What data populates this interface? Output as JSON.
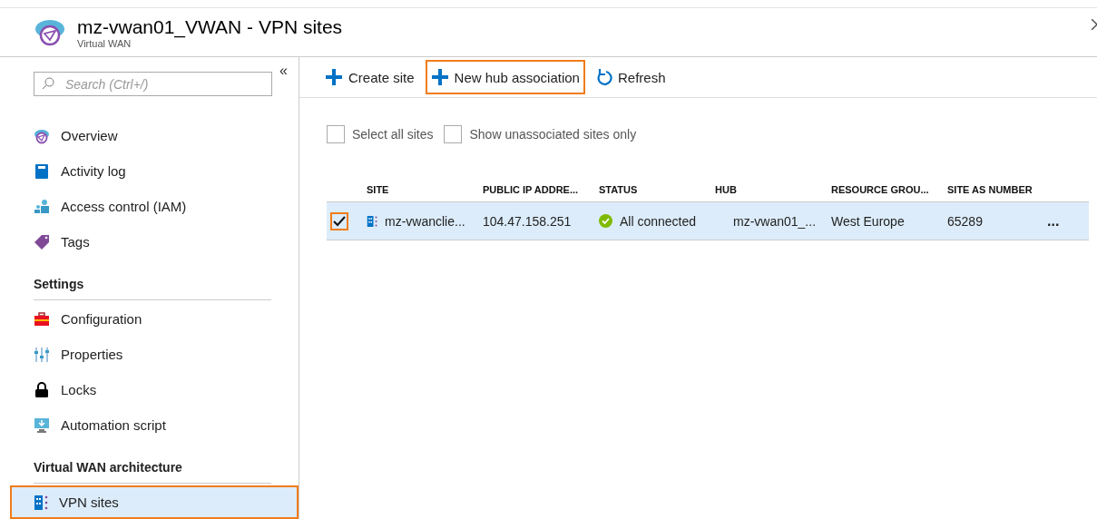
{
  "header": {
    "title": "mz-vwan01_VWAN - VPN sites",
    "subtitle": "Virtual WAN"
  },
  "sidebar": {
    "search": {
      "placeholder": "Search (Ctrl+/)"
    },
    "collapse": "«",
    "sections": [
      {
        "items": [
          {
            "label": "Overview",
            "selected": false,
            "highlighted": false
          },
          {
            "label": "Activity log",
            "selected": false,
            "highlighted": false
          },
          {
            "label": "Access control (IAM)",
            "selected": false,
            "highlighted": false
          },
          {
            "label": "Tags",
            "selected": false,
            "highlighted": false
          }
        ]
      },
      {
        "heading": "Settings",
        "items": [
          {
            "label": "Configuration",
            "selected": false,
            "highlighted": false
          },
          {
            "label": "Properties",
            "selected": false,
            "highlighted": false
          },
          {
            "label": "Locks",
            "selected": false,
            "highlighted": false
          },
          {
            "label": "Automation script",
            "selected": false,
            "highlighted": false
          }
        ]
      },
      {
        "heading": "Virtual WAN architecture",
        "items": [
          {
            "label": "VPN sites",
            "selected": true,
            "highlighted": true
          }
        ]
      }
    ]
  },
  "toolbar": [
    {
      "label": "Create site",
      "kind": "add",
      "highlighted": false
    },
    {
      "label": "New hub association",
      "kind": "add",
      "highlighted": true
    },
    {
      "label": "Refresh",
      "kind": "refresh",
      "highlighted": false
    }
  ],
  "filters": [
    {
      "label": "Select all sites",
      "checked": false
    },
    {
      "label": "Show unassociated sites only",
      "checked": false
    }
  ],
  "table": {
    "columns": [
      "SITE",
      "PUBLIC IP ADDRE...",
      "STATUS",
      "HUB",
      "RESOURCE GROU...",
      "SITE AS NUMBER"
    ],
    "rows": [
      {
        "selected": true,
        "checked": true,
        "highlighted": true,
        "site": "mz-vwanclie...",
        "ip": "104.47.158.251",
        "status": "All connected",
        "hub": "mz-vwan01_...",
        "resource_group": "West Europe",
        "asn": "65289",
        "more": "..."
      }
    ]
  }
}
